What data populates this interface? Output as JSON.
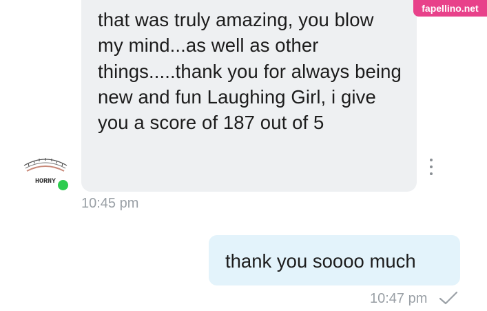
{
  "conversation": {
    "contact": {
      "avatar_icon": "horny-meter-avatar",
      "avatar_text": "HORNY",
      "online_color": "#2ecc4f"
    },
    "messages": [
      {
        "direction": "incoming",
        "text": "that was truly amazing, you blow my mind...as well as other things.....thank you for always being new and fun Laughing Girl, i give you a score of 187 out of 5",
        "time": "10:45 pm",
        "bubble_color": "#eef0f2"
      },
      {
        "direction": "outgoing",
        "text": "thank you soooo much",
        "time": "10:47 pm",
        "status_icon": "check-icon",
        "bubble_color": "#e3f3fb"
      }
    ],
    "more_icon": "more-vertical-icon"
  },
  "watermark": {
    "text": "fapellino.net",
    "color": "#e8418a"
  }
}
